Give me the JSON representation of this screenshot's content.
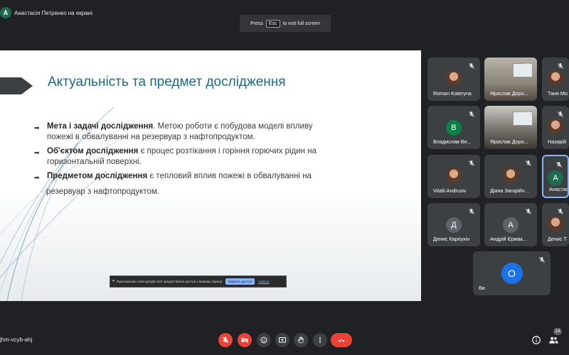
{
  "presenter": {
    "avatar_letter": "A",
    "text": "Анастасія Петренко на екрані"
  },
  "esc_notice": {
    "press": "Press",
    "key": "Esc",
    "suffix": "to exit full screen"
  },
  "slide": {
    "title": "Актуальність та предмет дослідження",
    "bullets": [
      {
        "bold": "Мета і задачі дослідження",
        "text": ". Метою роботи є побудова моделі впливу",
        "cont": "пожежі в обвалуванні на резервуар з нафтопродуктом."
      },
      {
        "bold": "Об'єктом дослідження",
        "text": " є процес розтікання і горіння горючих рідин на",
        "cont": "горизонтальній поверхні."
      },
      {
        "bold": "Предметом дослідження",
        "text": " є тепловий вплив пожежі в обвалуванні на",
        "cont": ""
      }
    ],
    "last_line": "резервуар з нафтопродуктом."
  },
  "share_banner": {
    "text": "Приложению meet.google.com предоставлен доступ к вашему экрану.",
    "stop_label": "Закрыть доступ",
    "hide_label": "Скрыть"
  },
  "participants": [
    {
      "name": "Roman Kateryna",
      "type": "photo"
    },
    {
      "name": "Ярослав Доро...",
      "type": "video"
    },
    {
      "name": "Таня Мо",
      "type": "photo"
    },
    {
      "name": "Владислав Ве...",
      "type": "letter",
      "letter": "B",
      "color": "#0b8043"
    },
    {
      "name": "Ярослав Доро...",
      "type": "video"
    },
    {
      "name": "Назарій",
      "type": "photo"
    },
    {
      "name": "Vitalii Andrusiv",
      "type": "photo"
    },
    {
      "name": "Діана Загорійч...",
      "type": "photo"
    },
    {
      "name": "Анастас",
      "type": "letter",
      "letter": "A",
      "color": "#1e6b4f"
    },
    {
      "name": "Денис Карпухін",
      "type": "letter",
      "letter": "Д",
      "color": "#5f6368"
    },
    {
      "name": "Андрій Єрмак...",
      "type": "letter",
      "letter": "A",
      "color": "#5f6368"
    },
    {
      "name": "Денис Т",
      "type": "photo"
    },
    {
      "name": "Ви",
      "type": "letter",
      "letter": "O",
      "color": "#1a73e8"
    }
  ],
  "meeting_code": "jhm-vcyb-ahj",
  "participant_count": "14",
  "colors": {
    "accent_red": "#ea4335",
    "control_grey": "#3c4043",
    "title_blue": "#1a6a84"
  }
}
